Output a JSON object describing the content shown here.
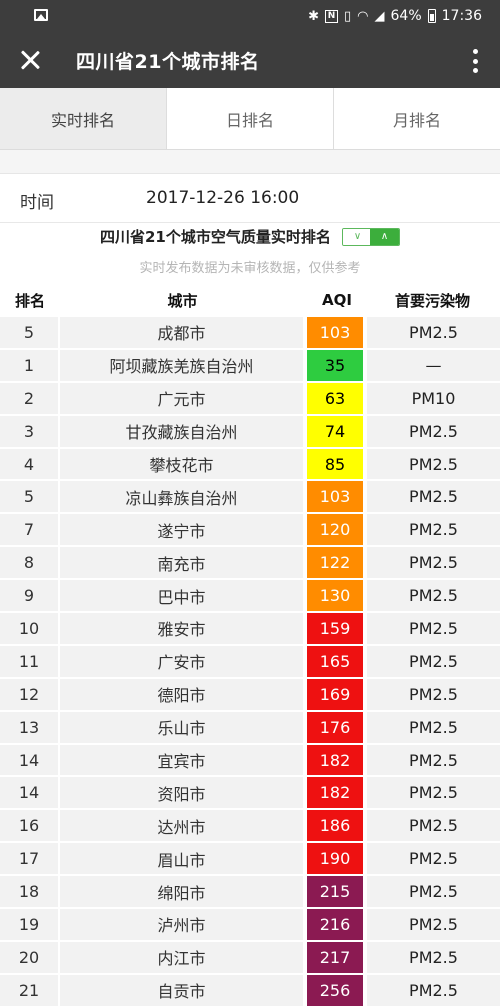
{
  "status_bar": {
    "battery": "64%",
    "time": "17:36",
    "icons": [
      "gallery-icon",
      "bluetooth-icon",
      "nfc-icon",
      "vibrate-icon",
      "wifi-icon",
      "signal-icon",
      "battery-icon"
    ]
  },
  "title_bar": {
    "title": "四川省21个城市排名"
  },
  "tabs": [
    {
      "label": "实时排名",
      "active": true
    },
    {
      "label": "日排名",
      "active": false
    },
    {
      "label": "月排名",
      "active": false
    }
  ],
  "time_row": {
    "label": "时间",
    "value": "2017-12-26 16:00"
  },
  "table": {
    "title": "四川省21个城市空气质量实时排名",
    "toggle_left": "∨",
    "toggle_right": "∧",
    "notice": "实时发布数据为未审核数据，仅供参考",
    "headers": {
      "rank": "排名",
      "city": "城市",
      "aqi": "AQI",
      "pollutant": "首要污染物"
    },
    "rows": [
      {
        "rank": "5",
        "city": "成都市",
        "aqi": "103",
        "level": "usg",
        "pollutant": "PM2.5"
      },
      {
        "rank": "1",
        "city": "阿坝藏族羌族自治州",
        "aqi": "35",
        "level": "good",
        "pollutant": "—"
      },
      {
        "rank": "2",
        "city": "广元市",
        "aqi": "63",
        "level": "moderate",
        "pollutant": "PM10"
      },
      {
        "rank": "3",
        "city": "甘孜藏族自治州",
        "aqi": "74",
        "level": "moderate",
        "pollutant": "PM2.5"
      },
      {
        "rank": "4",
        "city": "攀枝花市",
        "aqi": "85",
        "level": "moderate",
        "pollutant": "PM2.5"
      },
      {
        "rank": "5",
        "city": "凉山彝族自治州",
        "aqi": "103",
        "level": "usg",
        "pollutant": "PM2.5"
      },
      {
        "rank": "7",
        "city": "遂宁市",
        "aqi": "120",
        "level": "usg",
        "pollutant": "PM2.5"
      },
      {
        "rank": "8",
        "city": "南充市",
        "aqi": "122",
        "level": "usg",
        "pollutant": "PM2.5"
      },
      {
        "rank": "9",
        "city": "巴中市",
        "aqi": "130",
        "level": "usg",
        "pollutant": "PM2.5"
      },
      {
        "rank": "10",
        "city": "雅安市",
        "aqi": "159",
        "level": "unhealthy",
        "pollutant": "PM2.5"
      },
      {
        "rank": "11",
        "city": "广安市",
        "aqi": "165",
        "level": "unhealthy",
        "pollutant": "PM2.5"
      },
      {
        "rank": "12",
        "city": "德阳市",
        "aqi": "169",
        "level": "unhealthy",
        "pollutant": "PM2.5"
      },
      {
        "rank": "13",
        "city": "乐山市",
        "aqi": "176",
        "level": "unhealthy",
        "pollutant": "PM2.5"
      },
      {
        "rank": "14",
        "city": "宜宾市",
        "aqi": "182",
        "level": "unhealthy",
        "pollutant": "PM2.5"
      },
      {
        "rank": "14",
        "city": "资阳市",
        "aqi": "182",
        "level": "unhealthy",
        "pollutant": "PM2.5"
      },
      {
        "rank": "16",
        "city": "达州市",
        "aqi": "186",
        "level": "unhealthy",
        "pollutant": "PM2.5"
      },
      {
        "rank": "17",
        "city": "眉山市",
        "aqi": "190",
        "level": "unhealthy",
        "pollutant": "PM2.5"
      },
      {
        "rank": "18",
        "city": "绵阳市",
        "aqi": "215",
        "level": "very",
        "pollutant": "PM2.5"
      },
      {
        "rank": "19",
        "city": "泸州市",
        "aqi": "216",
        "level": "very",
        "pollutant": "PM2.5"
      },
      {
        "rank": "20",
        "city": "内江市",
        "aqi": "217",
        "level": "very",
        "pollutant": "PM2.5"
      },
      {
        "rank": "21",
        "city": "自贡市",
        "aqi": "256",
        "level": "very",
        "pollutant": "PM2.5"
      }
    ]
  },
  "colors": {
    "header_bg": "#3d3d3d",
    "aqi_good": "#2ecc40",
    "aqi_moderate": "#ffff00",
    "aqi_unhealthy_sensitive": "#ff8c00",
    "aqi_unhealthy": "#ee1111",
    "aqi_very_unhealthy": "#8b1a52",
    "toggle_green": "#3cae3c"
  }
}
